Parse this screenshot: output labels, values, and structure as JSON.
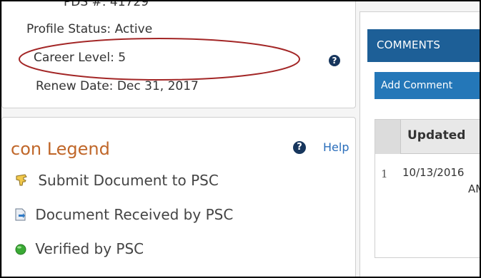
{
  "profile": {
    "cut_off_label": "PDS #: 41729",
    "status_label": "Profile Status:",
    "status_value": "Active",
    "career_label": "Career Level:",
    "career_value": "5",
    "renew_label": "Renew Date:",
    "renew_value": "Dec 31, 2017",
    "help_glyph": "?",
    "highlight_color": "#a32626"
  },
  "legend": {
    "title": "con Legend",
    "help_glyph": "?",
    "help_label": "Help",
    "items": [
      {
        "label": "Submit Document to PSC",
        "icon": "hand-point-icon"
      },
      {
        "label": "Document Received by PSC",
        "icon": "document-received-icon"
      },
      {
        "label": "Verified by PSC",
        "icon": "green-circle-icon"
      }
    ]
  },
  "comments": {
    "header": "COMMENTS",
    "add_button": "Add Comment",
    "columns": [
      "Updated"
    ],
    "rows": [
      {
        "num": "1",
        "date": "10/13/2016",
        "time": "AM"
      }
    ]
  },
  "colors": {
    "accent": "#1d5f97",
    "legend_title": "#c0672a",
    "link": "#2a6ebb"
  }
}
